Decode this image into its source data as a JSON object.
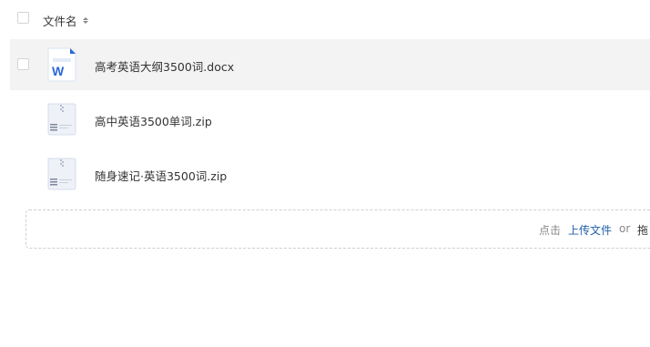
{
  "header": {
    "column_label": "文件名"
  },
  "files": [
    {
      "name": "高考英语大纲3500词.docx",
      "icon": "word-doc-icon"
    },
    {
      "name": "高中英语3500单词.zip",
      "icon": "zip-archive-icon"
    },
    {
      "name": "随身速记·英语3500词.zip",
      "icon": "zip-archive-icon"
    }
  ],
  "upload": {
    "prefix": "点击",
    "link": "上传文件",
    "or": "or",
    "suffix": "拖"
  },
  "colors": {
    "word_blue": "#2b66d6",
    "link_blue": "#1f5fa8"
  }
}
